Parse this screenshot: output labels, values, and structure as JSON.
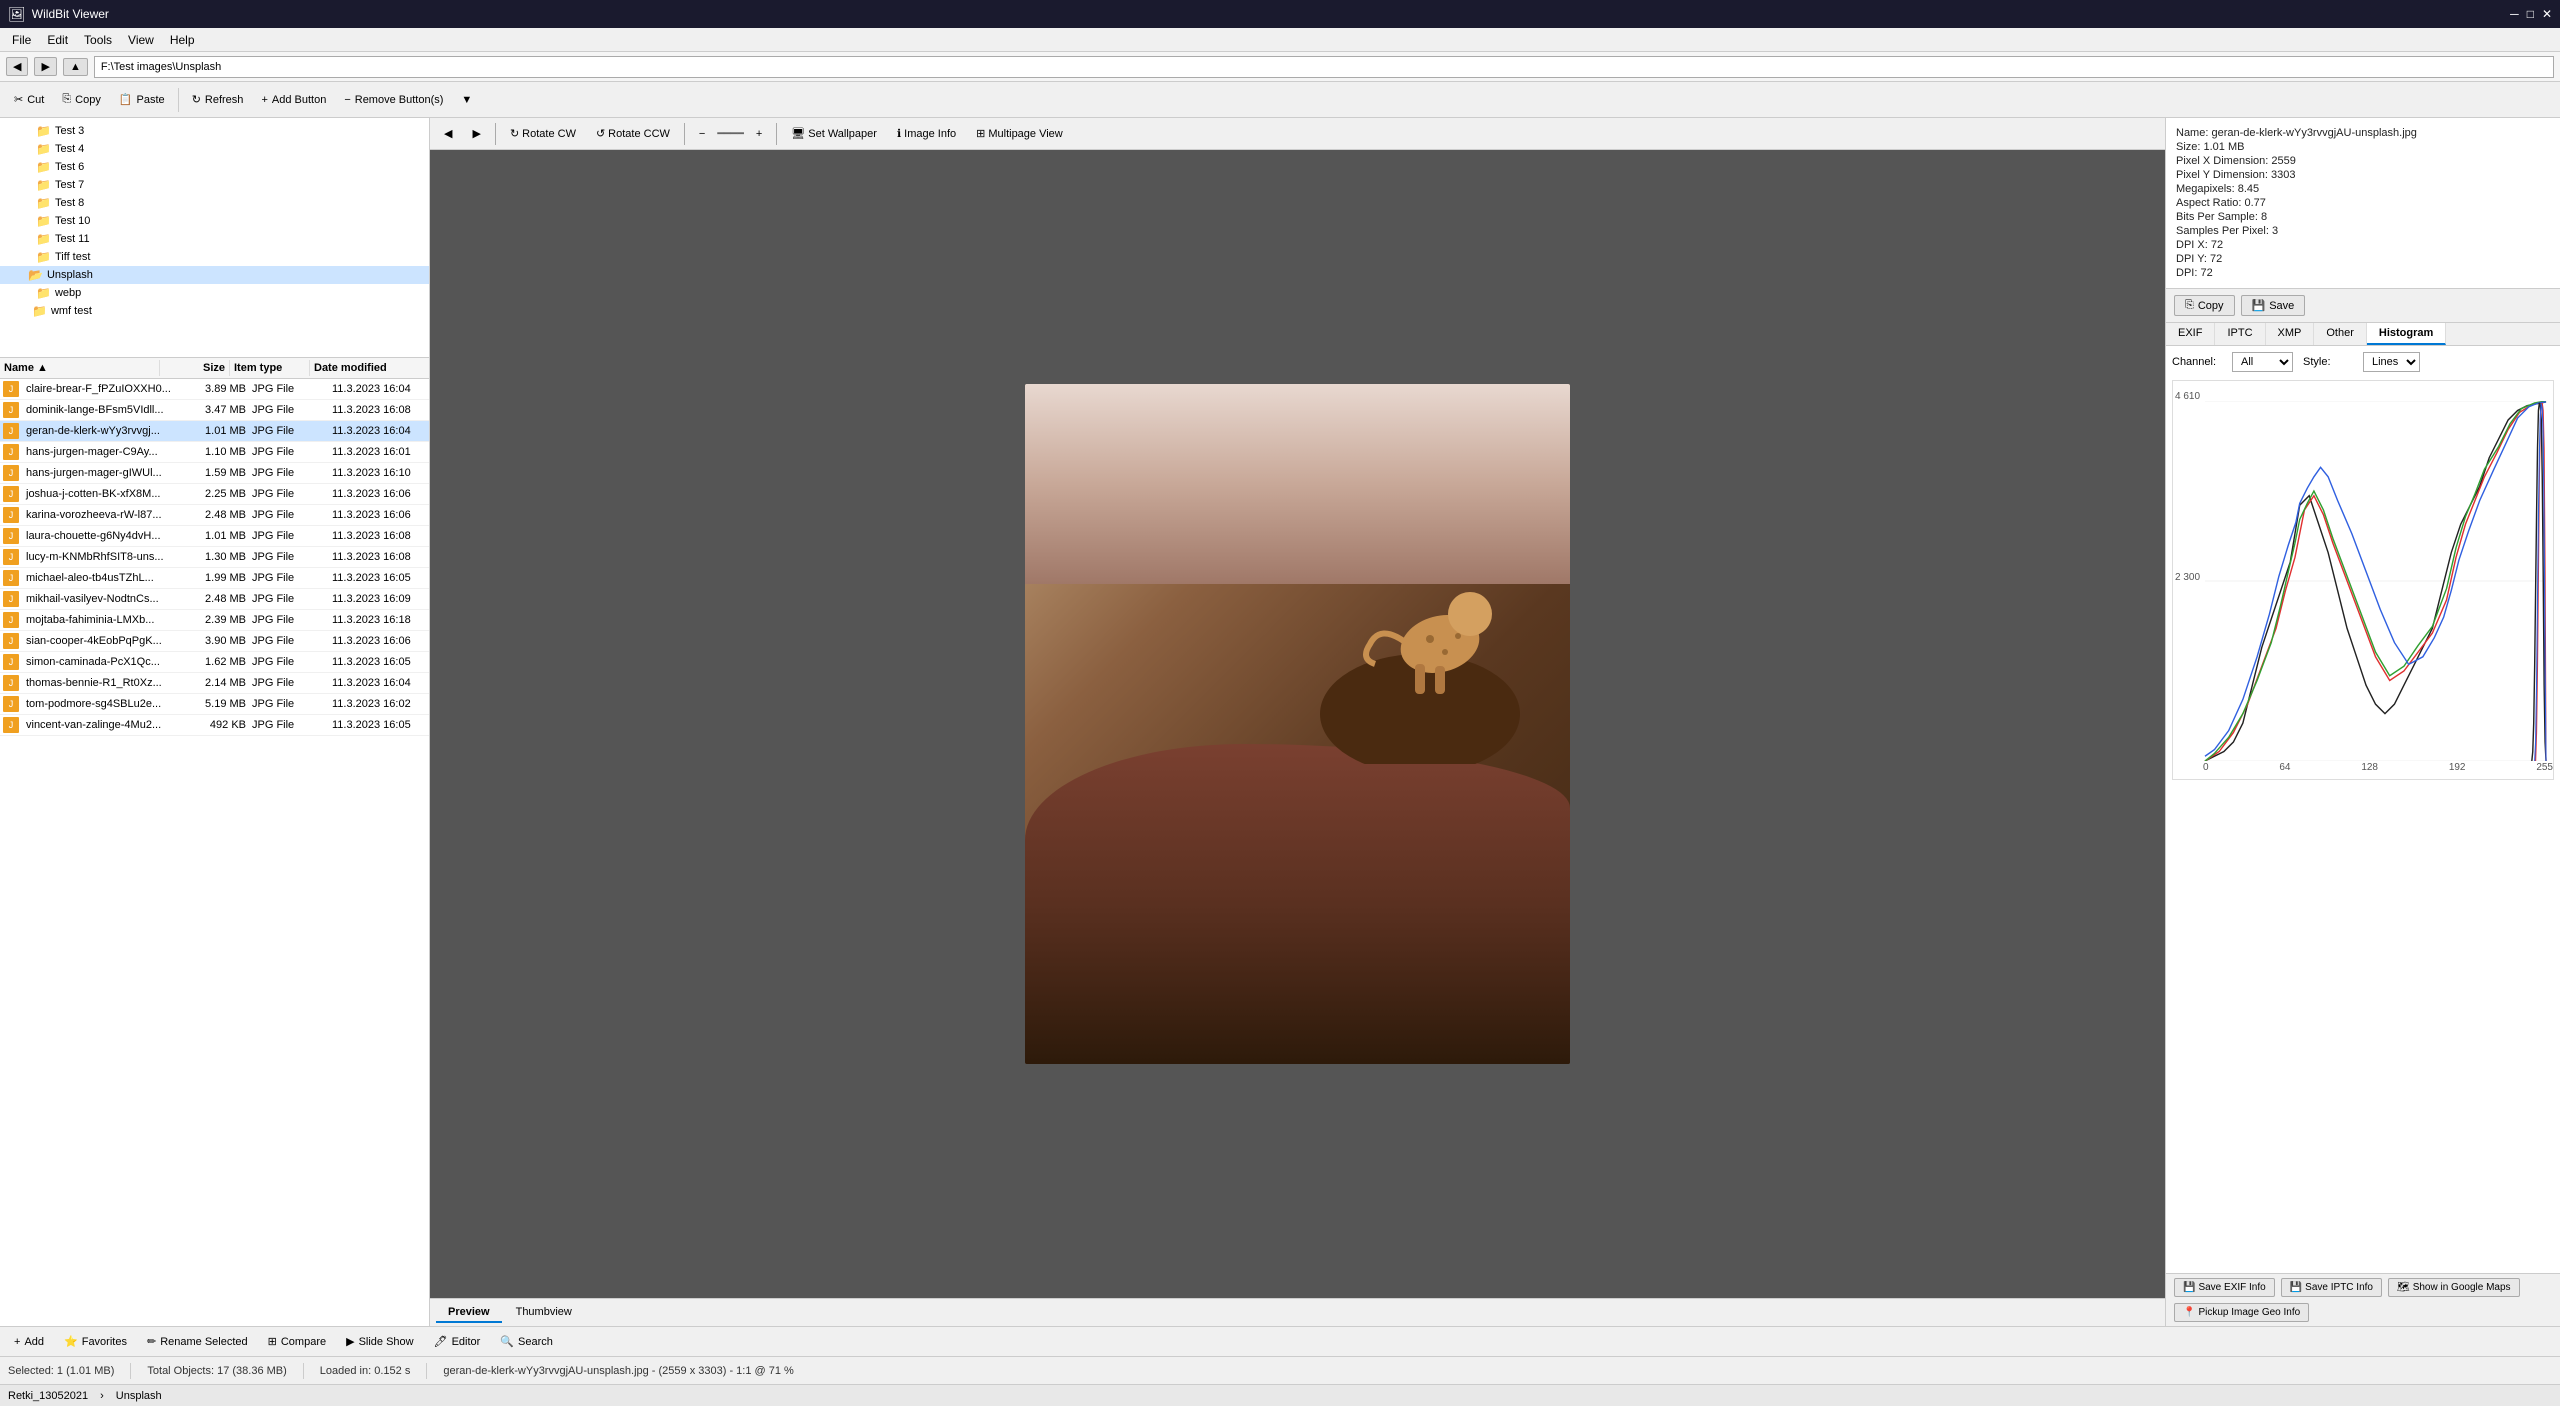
{
  "app": {
    "title": "WildBit Viewer",
    "icon": "🖼"
  },
  "menu": {
    "items": [
      "File",
      "Edit",
      "Tools",
      "View",
      "Help"
    ]
  },
  "address_bar": {
    "back_label": "◀",
    "forward_label": "▶",
    "path": "F:\\Test images\\Unsplash"
  },
  "toolbar": {
    "cut_label": "✂ Cut",
    "copy_label": "Copy",
    "paste_label": "Paste",
    "refresh_label": "Refresh",
    "add_button_label": "Add Button",
    "remove_button_label": "Remove Button(s)",
    "filter_icon": "▼"
  },
  "folder_tree": {
    "items": [
      {
        "label": "Test 3",
        "indent": 2,
        "selected": false
      },
      {
        "label": "Test 4",
        "indent": 2,
        "selected": false
      },
      {
        "label": "Test 6",
        "indent": 2,
        "selected": false
      },
      {
        "label": "Test 7",
        "indent": 2,
        "selected": false
      },
      {
        "label": "Test 8",
        "indent": 2,
        "selected": false
      },
      {
        "label": "Test 10",
        "indent": 2,
        "selected": false
      },
      {
        "label": "Test 11",
        "indent": 2,
        "selected": false
      },
      {
        "label": "Tiff test",
        "indent": 2,
        "selected": false
      },
      {
        "label": "Unsplash",
        "indent": 2,
        "selected": true
      },
      {
        "label": "webp",
        "indent": 2,
        "selected": false
      },
      {
        "label": "+ wmf test",
        "indent": 2,
        "selected": false
      }
    ]
  },
  "file_list": {
    "columns": [
      "Name",
      "Size",
      "Item type",
      "Date modified"
    ],
    "files": [
      {
        "name": "claire-brear-F_fPZuIOXXH0...",
        "size": "3.89 MB",
        "type": "JPG File",
        "date": "11.3.2023 16:04",
        "selected": false
      },
      {
        "name": "dominik-lange-BFsm5VIdll...",
        "size": "3.47 MB",
        "type": "JPG File",
        "date": "11.3.2023 16:08",
        "selected": false
      },
      {
        "name": "geran-de-klerk-wYy3rvvgj...",
        "size": "1.01 MB",
        "type": "JPG File",
        "date": "11.3.2023 16:04",
        "selected": true
      },
      {
        "name": "hans-jurgen-mager-C9Ay...",
        "size": "1.10 MB",
        "type": "JPG File",
        "date": "11.3.2023 16:01",
        "selected": false
      },
      {
        "name": "hans-jurgen-mager-gIWUl...",
        "size": "1.59 MB",
        "type": "JPG File",
        "date": "11.3.2023 16:10",
        "selected": false
      },
      {
        "name": "joshua-j-cotten-BK-xfX8M...",
        "size": "2.25 MB",
        "type": "JPG File",
        "date": "11.3.2023 16:06",
        "selected": false
      },
      {
        "name": "karina-vorozheeva-rW-l87...",
        "size": "2.48 MB",
        "type": "JPG File",
        "date": "11.3.2023 16:06",
        "selected": false
      },
      {
        "name": "laura-chouette-g6Ny4dvH...",
        "size": "1.01 MB",
        "type": "JPG File",
        "date": "11.3.2023 16:08",
        "selected": false
      },
      {
        "name": "lucy-m-KNMbRhfSIT8-uns...",
        "size": "1.30 MB",
        "type": "JPG File",
        "date": "11.3.2023 16:08",
        "selected": false
      },
      {
        "name": "michael-aleo-tb4usTZhL...",
        "size": "1.99 MB",
        "type": "JPG File",
        "date": "11.3.2023 16:05",
        "selected": false
      },
      {
        "name": "mikhail-vasilyev-NodtnCs...",
        "size": "2.48 MB",
        "type": "JPG File",
        "date": "11.3.2023 16:09",
        "selected": false
      },
      {
        "name": "mojtaba-fahiminia-LMXb...",
        "size": "2.39 MB",
        "type": "JPG File",
        "date": "11.3.2023 16:18",
        "selected": false
      },
      {
        "name": "sian-cooper-4kEobPqPgK...",
        "size": "3.90 MB",
        "type": "JPG File",
        "date": "11.3.2023 16:06",
        "selected": false
      },
      {
        "name": "simon-caminada-PcX1Qc...",
        "size": "1.62 MB",
        "type": "JPG File",
        "date": "11.3.2023 16:05",
        "selected": false
      },
      {
        "name": "thomas-bennie-R1_Rt0Xz...",
        "size": "2.14 MB",
        "type": "JPG File",
        "date": "11.3.2023 16:04",
        "selected": false
      },
      {
        "name": "tom-podmore-sg4SBLu2e...",
        "size": "5.19 MB",
        "type": "JPG File",
        "date": "11.3.2023 16:02",
        "selected": false
      },
      {
        "name": "vincent-van-zalinge-4Mu2...",
        "size": "492 KB",
        "type": "JPG File",
        "date": "11.3.2023 16:05",
        "selected": false
      }
    ]
  },
  "viewer": {
    "toolbar": {
      "prev_label": "◀",
      "next_label": "▶",
      "rotate_cw_label": "Rotate CW",
      "rotate_ccw_label": "Rotate CCW",
      "zoom_out_label": "−",
      "zoom_in_label": "+",
      "set_wallpaper_label": "Set Wallpaper",
      "image_info_label": "Image Info",
      "multipage_label": "Multipage View"
    },
    "tabs": {
      "preview_label": "Preview",
      "thumbview_label": "Thumbview"
    }
  },
  "image_info": {
    "filename": "Name: geran-de-klerk-wYy3rvvgjAU-unsplash.jpg",
    "size": "Size: 1.01 MB",
    "pixel_x": "Pixel X Dimension: 2559",
    "pixel_y": "Pixel Y Dimension: 3303",
    "megapixels": "Megapixels: 8.45",
    "aspect_ratio": "Aspect Ratio: 0.77",
    "bits_per_sample": "Bits Per Sample: 8",
    "samples_per_pixel": "Samples Per Pixel: 3",
    "dpi_x": "DPI X: 72",
    "dpi_y": "DPI Y: 72",
    "dpi": "DPI: 72"
  },
  "info_actions": {
    "copy_label": "Copy",
    "save_label": "Save"
  },
  "info_tabs": {
    "tabs": [
      "EXIF",
      "IPTC",
      "XMP",
      "Other",
      "Histogram"
    ]
  },
  "histogram": {
    "channel_label": "Channel:",
    "channel_value": "All",
    "style_label": "Style:",
    "style_value": "Lines",
    "y_labels": [
      "4 610",
      "2 300"
    ],
    "x_labels": [
      "0",
      "64",
      "128",
      "192",
      "255"
    ]
  },
  "bottom_toolbar": {
    "add_label": "Add",
    "favorites_label": "Favorites",
    "rename_label": "Rename Selected",
    "compare_label": "Compare",
    "slideshow_label": "Slide Show",
    "editor_label": "Editor",
    "search_label": "Search"
  },
  "status_bar": {
    "selected": "Selected: 1 (1.01 MB)",
    "total": "Total Objects: 17 (38.36 MB)",
    "loaded": "Loaded in: 0.152 s",
    "image_info": "geran-de-klerk-wYy3rvvgjAU-unsplash.jpg - (2559 x 3303) - 1:1 @ 71 %"
  },
  "bottom_info": {
    "undo_label": "Retki_13052021",
    "folder_label": "Unsplash"
  },
  "right_bottom": {
    "save_exif_label": "Save EXIF Info",
    "save_iptc_label": "Save IPTC Info",
    "show_google_maps": "Show in Google Maps",
    "pickup_geo": "Pickup Image Geo Info"
  }
}
